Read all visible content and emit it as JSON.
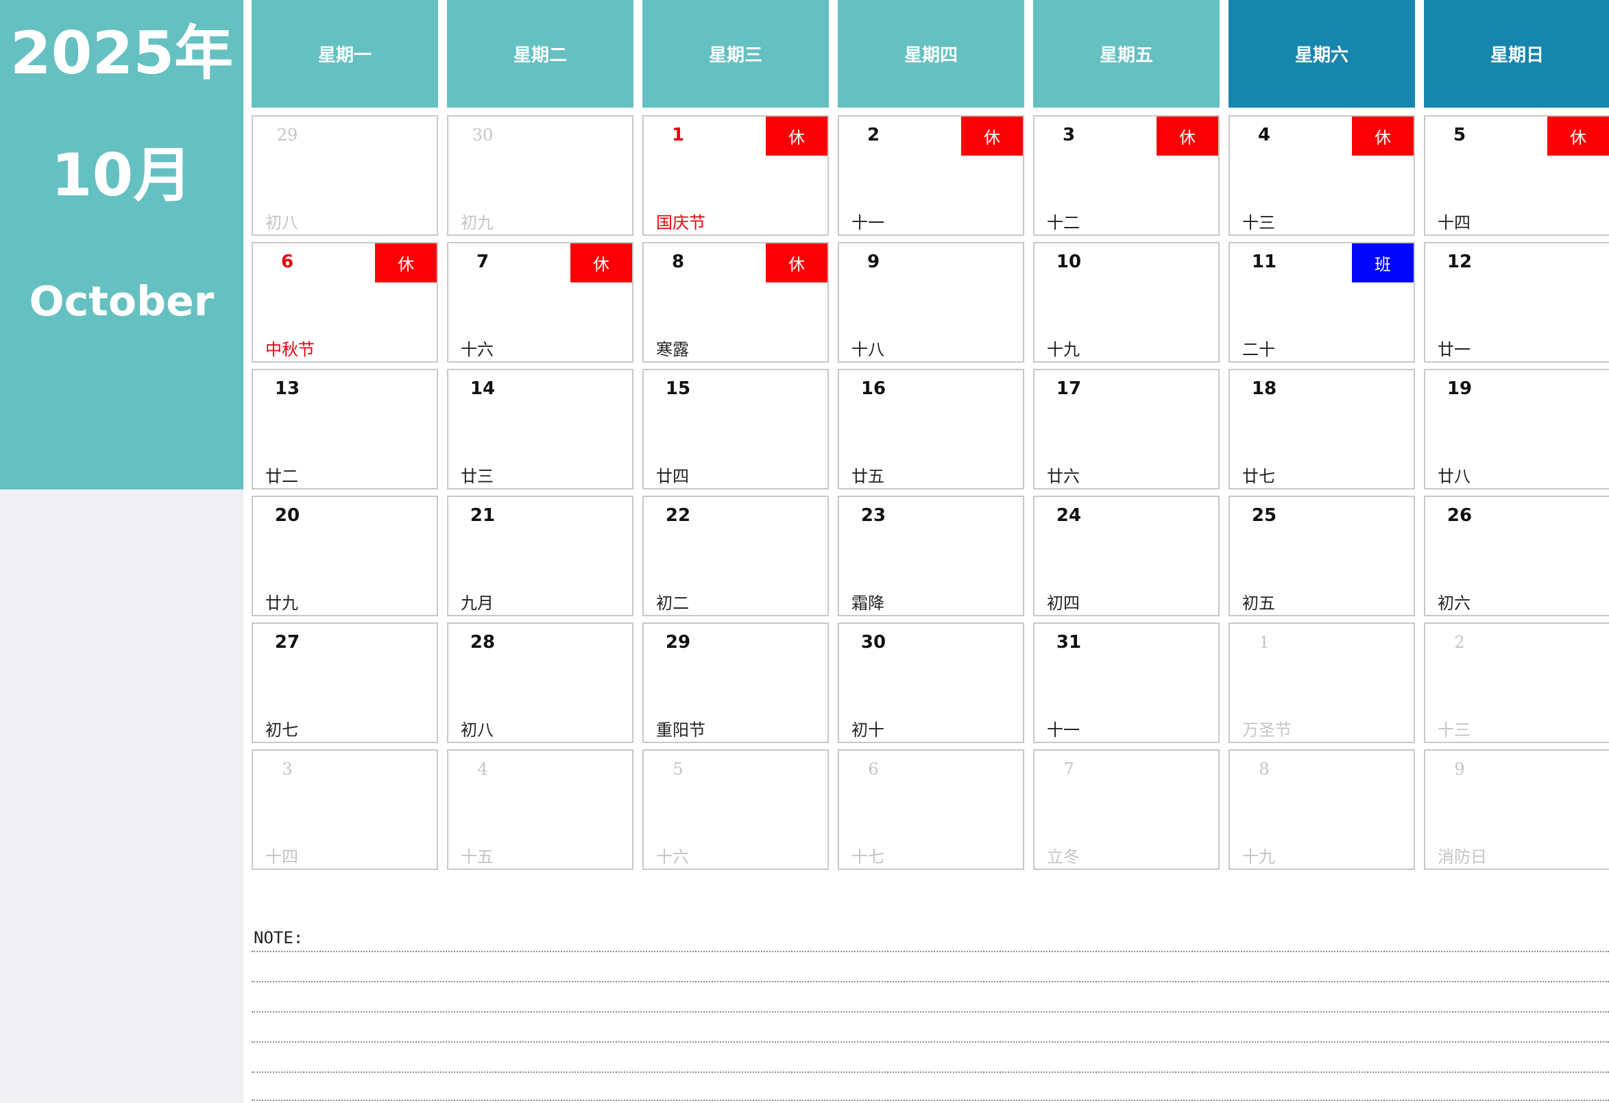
{
  "sidebar": {
    "year": "2025年",
    "month_cn": "10月",
    "month_en": "October"
  },
  "weekdays": [
    "星期一",
    "星期二",
    "星期三",
    "星期四",
    "星期五",
    "星期六",
    "星期日"
  ],
  "weekend_header_color": "#1786ad",
  "weekday_header_color": "#65c0c1",
  "rest_badge_color": "#fa0006",
  "work_badge_color": "#0006fa",
  "weeks": [
    [
      {
        "day": "29",
        "lunar": "初八",
        "other": true
      },
      {
        "day": "30",
        "lunar": "初九",
        "other": true
      },
      {
        "day": "1",
        "lunar": "国庆节",
        "badge": "休",
        "badge_type": "rest",
        "red_date": true,
        "red_lunar": true
      },
      {
        "day": "2",
        "lunar": "十一",
        "badge": "休",
        "badge_type": "rest"
      },
      {
        "day": "3",
        "lunar": "十二",
        "badge": "休",
        "badge_type": "rest"
      },
      {
        "day": "4",
        "lunar": "十三",
        "badge": "休",
        "badge_type": "rest"
      },
      {
        "day": "5",
        "lunar": "十四",
        "badge": "休",
        "badge_type": "rest"
      }
    ],
    [
      {
        "day": "6",
        "lunar": "中秋节",
        "badge": "休",
        "badge_type": "rest",
        "red_date": true,
        "red_lunar": true
      },
      {
        "day": "7",
        "lunar": "十六",
        "badge": "休",
        "badge_type": "rest"
      },
      {
        "day": "8",
        "lunar": "寒露",
        "badge": "休",
        "badge_type": "rest"
      },
      {
        "day": "9",
        "lunar": "十八"
      },
      {
        "day": "10",
        "lunar": "十九"
      },
      {
        "day": "11",
        "lunar": "二十",
        "badge": "班",
        "badge_type": "work"
      },
      {
        "day": "12",
        "lunar": "廿一"
      }
    ],
    [
      {
        "day": "13",
        "lunar": "廿二"
      },
      {
        "day": "14",
        "lunar": "廿三"
      },
      {
        "day": "15",
        "lunar": "廿四"
      },
      {
        "day": "16",
        "lunar": "廿五"
      },
      {
        "day": "17",
        "lunar": "廿六"
      },
      {
        "day": "18",
        "lunar": "廿七"
      },
      {
        "day": "19",
        "lunar": "廿八"
      }
    ],
    [
      {
        "day": "20",
        "lunar": "廿九"
      },
      {
        "day": "21",
        "lunar": "九月"
      },
      {
        "day": "22",
        "lunar": "初二"
      },
      {
        "day": "23",
        "lunar": "霜降"
      },
      {
        "day": "24",
        "lunar": "初四"
      },
      {
        "day": "25",
        "lunar": "初五"
      },
      {
        "day": "26",
        "lunar": "初六"
      }
    ],
    [
      {
        "day": "27",
        "lunar": "初七"
      },
      {
        "day": "28",
        "lunar": "初八"
      },
      {
        "day": "29",
        "lunar": "重阳节"
      },
      {
        "day": "30",
        "lunar": "初十"
      },
      {
        "day": "31",
        "lunar": "十一"
      },
      {
        "day": "1",
        "lunar": "万圣节",
        "other": true
      },
      {
        "day": "2",
        "lunar": "十三",
        "other": true
      }
    ],
    [
      {
        "day": "3",
        "lunar": "十四",
        "other": true
      },
      {
        "day": "4",
        "lunar": "十五",
        "other": true
      },
      {
        "day": "5",
        "lunar": "十六",
        "other": true
      },
      {
        "day": "6",
        "lunar": "十七",
        "other": true
      },
      {
        "day": "7",
        "lunar": "立冬",
        "other": true
      },
      {
        "day": "8",
        "lunar": "十九",
        "other": true
      },
      {
        "day": "9",
        "lunar": "消防日",
        "other": true
      }
    ]
  ],
  "notes": {
    "label": "NOTE:"
  }
}
